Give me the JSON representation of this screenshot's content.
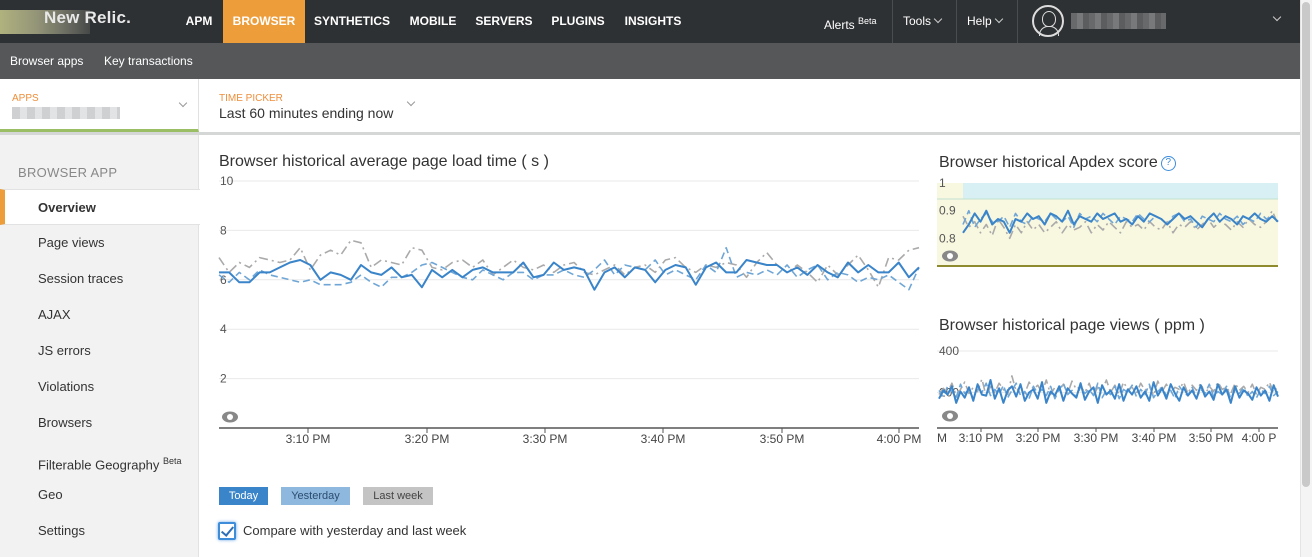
{
  "topnav": {
    "brand": "New Relic.",
    "items": [
      "APM",
      "BROWSER",
      "SYNTHETICS",
      "MOBILE",
      "SERVERS",
      "PLUGINS",
      "INSIGHTS"
    ],
    "active": "BROWSER",
    "alerts": "Alerts",
    "alerts_badge": "Beta",
    "tools": "Tools",
    "help": "Help"
  },
  "subnav": {
    "items": [
      "Browser apps",
      "Key transactions"
    ]
  },
  "pickers": {
    "apps_label": "APPS",
    "time_label": "TIME PICKER",
    "time_value": "Last 60 minutes ending now"
  },
  "sidebar": {
    "heading": "BROWSER APP",
    "items": [
      "Overview",
      "Page views",
      "Session traces",
      "AJAX",
      "JS errors",
      "Violations",
      "Browsers",
      "Filterable Geography",
      "Geo",
      "Settings"
    ],
    "beta_badge": "Beta"
  },
  "colors": {
    "today": "#3a84c9",
    "yesterday": "#6fa6d6",
    "lastweek": "#aaaaaa",
    "accent": "#ee9d3b"
  },
  "chart_data": [
    {
      "type": "line",
      "title": "Browser historical average page load time ( s )",
      "ylim": [
        0,
        10
      ],
      "yticks": [
        "10",
        "8",
        "6",
        "4",
        "2"
      ],
      "xticks": [
        "3:10 PM",
        "3:20 PM",
        "3:30 PM",
        "3:40 PM",
        "3:50 PM",
        "4:00 PM"
      ],
      "series": [
        {
          "name": "Today",
          "values": [
            6.3,
            6.3,
            5.9,
            5.9,
            6.3,
            6.3,
            6.5,
            6.7,
            6.8,
            6.6,
            6.0,
            6.3,
            6.2,
            6.0,
            6.6,
            6.3,
            6.2,
            6.5,
            6.1,
            6.2,
            5.7,
            6.4,
            6.1,
            6.4,
            6.1,
            6.4,
            6.5,
            6.3,
            6.3,
            6.3,
            6.7,
            6.1,
            6.2,
            6.7,
            6.4,
            6.5,
            6.4,
            5.6,
            6.3,
            6.5,
            6.1,
            6.5,
            6.4,
            5.9,
            6.4,
            6.6,
            6.5,
            5.8,
            6.5,
            6.7,
            6.3,
            6.3,
            6.8,
            6.7,
            6.6,
            6.6,
            6.3,
            6.5,
            6.2,
            6.6,
            6.3,
            6.1,
            6.7,
            6.3,
            6.6,
            6.3,
            6.3,
            6.7,
            6.1,
            6.5
          ]
        },
        {
          "name": "Yesterday",
          "values": [
            6.2,
            5.9,
            6.3,
            6.0,
            6.4,
            6.2,
            6.1,
            6.0,
            5.9,
            6.0,
            5.8,
            5.8,
            5.8,
            5.9,
            6.2,
            5.9,
            5.7,
            6.1,
            6.1,
            6.3,
            6.6,
            6.7,
            6.5,
            6.3,
            6.1,
            6.0,
            6.4,
            6.2,
            6.0,
            6.3,
            6.3,
            6.0,
            6.2,
            6.2,
            6.4,
            6.2,
            6.1,
            6.4,
            6.8,
            6.2,
            6.6,
            6.5,
            6.4,
            6.8,
            6.2,
            6.4,
            6.2,
            6.0,
            6.6,
            6.3,
            7.3,
            6.1,
            6.3,
            6.2,
            6.4,
            6.2,
            6.6,
            6.1,
            6.4,
            6.6,
            6.0,
            6.3,
            6.2,
            5.9,
            6.1,
            6.0,
            6.2,
            5.9,
            5.6,
            6.5
          ]
        },
        {
          "name": "Last week",
          "values": [
            6.9,
            6.3,
            6.7,
            6.5,
            6.9,
            6.8,
            6.7,
            6.8,
            7.3,
            6.4,
            7.0,
            7.2,
            7.0,
            7.6,
            7.5,
            6.5,
            6.8,
            6.7,
            6.6,
            7.3,
            7.2,
            6.5,
            6.4,
            6.7,
            6.8,
            6.5,
            6.8,
            6.2,
            6.5,
            6.8,
            6.5,
            6.4,
            6.6,
            6.3,
            6.6,
            6.7,
            6.3,
            6.2,
            6.4,
            6.6,
            6.2,
            6.5,
            6.6,
            6.3,
            6.8,
            6.9,
            6.5,
            6.3,
            6.6,
            6.5,
            6.7,
            6.6,
            6.1,
            6.7,
            7.1,
            6.6,
            6.3,
            6.6,
            6.3,
            5.9,
            6.6,
            6.2,
            6.6,
            7.0,
            6.4,
            5.7,
            6.9,
            6.8,
            7.2,
            7.3
          ]
        }
      ]
    },
    {
      "type": "line",
      "title": "Browser historical Apdex score",
      "yticks": [
        "1",
        "0.9",
        "0.8"
      ],
      "series": [
        {
          "name": "Today",
          "values": [
            0.82,
            0.85,
            0.89,
            0.86,
            0.9,
            0.85,
            0.87,
            0.86,
            0.82,
            0.87,
            0.86,
            0.89,
            0.87,
            0.88,
            0.85,
            0.89,
            0.88,
            0.86,
            0.9,
            0.85,
            0.88,
            0.87,
            0.86,
            0.89,
            0.87,
            0.88,
            0.89,
            0.86,
            0.87,
            0.85,
            0.88,
            0.86,
            0.89,
            0.88,
            0.87,
            0.85,
            0.87,
            0.89,
            0.87,
            0.88,
            0.86,
            0.84,
            0.87,
            0.89,
            0.86,
            0.88,
            0.87,
            0.85,
            0.88,
            0.87,
            0.89,
            0.87,
            0.86,
            0.88,
            0.86
          ]
        },
        {
          "name": "Yesterday",
          "values": [
            0.85,
            0.9,
            0.84,
            0.87,
            0.89,
            0.86,
            0.86,
            0.88,
            0.84,
            0.89,
            0.86,
            0.85,
            0.88,
            0.87,
            0.86,
            0.89,
            0.87,
            0.86,
            0.88,
            0.84,
            0.89,
            0.87,
            0.88,
            0.86,
            0.89,
            0.87,
            0.85,
            0.88,
            0.87,
            0.86,
            0.89,
            0.87,
            0.86,
            0.88,
            0.87,
            0.85,
            0.88,
            0.89,
            0.86,
            0.87,
            0.84,
            0.88,
            0.87,
            0.86,
            0.89,
            0.87,
            0.86,
            0.88,
            0.85,
            0.87,
            0.86,
            0.89,
            0.87,
            0.88,
            0.86
          ]
        },
        {
          "name": "Last week",
          "values": [
            0.88,
            0.84,
            0.86,
            0.82,
            0.85,
            0.81,
            0.87,
            0.84,
            0.8,
            0.85,
            0.82,
            0.86,
            0.83,
            0.85,
            0.82,
            0.84,
            0.86,
            0.82,
            0.85,
            0.83,
            0.84,
            0.86,
            0.82,
            0.85,
            0.83,
            0.86,
            0.84,
            0.82,
            0.86,
            0.84,
            0.85,
            0.83,
            0.86,
            0.84,
            0.83,
            0.86,
            0.82,
            0.85,
            0.84,
            0.86,
            0.83,
            0.85,
            0.87,
            0.84,
            0.86,
            0.85,
            0.83,
            0.86,
            0.84,
            0.87,
            0.85,
            0.84,
            0.86,
            0.9,
            0.85
          ]
        }
      ]
    },
    {
      "type": "line",
      "title": "Browser historical page views ( ppm )",
      "ylim": [
        0,
        400
      ],
      "yticks": [
        "400",
        "200"
      ],
      "xticks": [
        "M",
        "3:10 PM",
        "3:20 PM",
        "3:30 PM",
        "3:40 PM",
        "3:50 PM",
        "4:00 P"
      ],
      "series": [
        {
          "name": "Today",
          "values": [
            170,
            210,
            190,
            230,
            150,
            205,
            175,
            225,
            160,
            240,
            190,
            185,
            260,
            170,
            220,
            150,
            210,
            230,
            180,
            240,
            160,
            200,
            215,
            170,
            250,
            150,
            205,
            185,
            230,
            160,
            220,
            195,
            175,
            245,
            165,
            205,
            225,
            150,
            235,
            190,
            210,
            170,
            240,
            160,
            215,
            190,
            230,
            175,
            205,
            160,
            250,
            185,
            220,
            170,
            240,
            195,
            160,
            225,
            185,
            210,
            170,
            235,
            180,
            205,
            165,
            240,
            190,
            215,
            150,
            230,
            175,
            210,
            195,
            165,
            225,
            185,
            210,
            160,
            235,
            180
          ]
        },
        {
          "name": "Yesterday",
          "values": [
            210,
            180,
            230,
            205,
            175,
            240,
            195,
            215,
            170,
            225,
            200,
            245,
            185,
            215,
            190,
            235,
            175,
            210,
            245,
            185,
            205,
            170,
            230,
            195,
            215,
            185,
            230,
            170,
            215,
            245,
            190,
            210,
            175,
            230,
            195,
            215,
            185,
            245,
            175,
            210,
            190,
            230,
            170,
            215,
            200,
            235,
            180,
            215,
            190,
            240,
            175,
            205,
            225,
            185,
            210,
            170,
            230,
            200,
            185,
            225,
            175,
            215,
            195,
            240,
            180,
            205,
            190,
            230,
            170,
            210,
            195,
            225,
            180,
            205,
            175,
            215,
            195,
            230,
            185,
            205
          ]
        },
        {
          "name": "Last week",
          "values": [
            190,
            220,
            200,
            245,
            185,
            215,
            250,
            195,
            225,
            205,
            265,
            180,
            230,
            200,
            245,
            215,
            190,
            280,
            205,
            230,
            195,
            250,
            215,
            235,
            200,
            260,
            190,
            225,
            210,
            240,
            195,
            255,
            215,
            230,
            200,
            245,
            185,
            225,
            210,
            260,
            200,
            235,
            190,
            250,
            215,
            225,
            195,
            245,
            210,
            230,
            185,
            255,
            205,
            240,
            200,
            225,
            215,
            250,
            195,
            235,
            210,
            245,
            190,
            230,
            205,
            250,
            215,
            225,
            195,
            245,
            210,
            230,
            200,
            240,
            190,
            225,
            215,
            250,
            200,
            230
          ]
        }
      ]
    }
  ],
  "legend": {
    "today": "Today",
    "yesterday": "Yesterday",
    "lastweek": "Last week"
  },
  "compare_label": "Compare with yesterday and last week"
}
